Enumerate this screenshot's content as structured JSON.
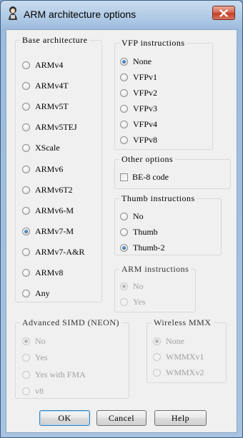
{
  "window": {
    "title": "ARM architecture options"
  },
  "base": {
    "legend": "Base architecture",
    "options": [
      "ARMv4",
      "ARMv4T",
      "ARMv5T",
      "ARMv5TEJ",
      "XScale",
      "ARMv6",
      "ARMv6T2",
      "ARMv6-M",
      "ARMv7-M",
      "ARMv7-A&R",
      "ARMv8",
      "Any"
    ],
    "selected": "ARMv7-M"
  },
  "vfp": {
    "legend": "VFP instructions",
    "options": [
      "None",
      "VFPv1",
      "VFPv2",
      "VFPv3",
      "VFPv4",
      "VFPv8"
    ],
    "selected": "None"
  },
  "other": {
    "legend": "Other options",
    "be8_label": "BE-8 code",
    "be8_checked": false
  },
  "thumb": {
    "legend": "Thumb instructions",
    "options": [
      "No",
      "Thumb",
      "Thumb-2"
    ],
    "selected": "Thumb-2"
  },
  "arm": {
    "legend": "ARM instructions",
    "options": [
      "No",
      "Yes"
    ],
    "selected": "No",
    "enabled": false
  },
  "neon": {
    "legend": "Advanced SIMD (NEON)",
    "options": [
      "No",
      "Yes",
      "Yes with FMA",
      "v8"
    ],
    "selected": "No",
    "enabled": false
  },
  "wmmx": {
    "legend": "Wireless MMX",
    "options": [
      "None",
      "WMMXv1",
      "WMMXv2"
    ],
    "selected": "None",
    "enabled": false
  },
  "buttons": {
    "ok": "OK",
    "cancel": "Cancel",
    "help": "Help"
  }
}
